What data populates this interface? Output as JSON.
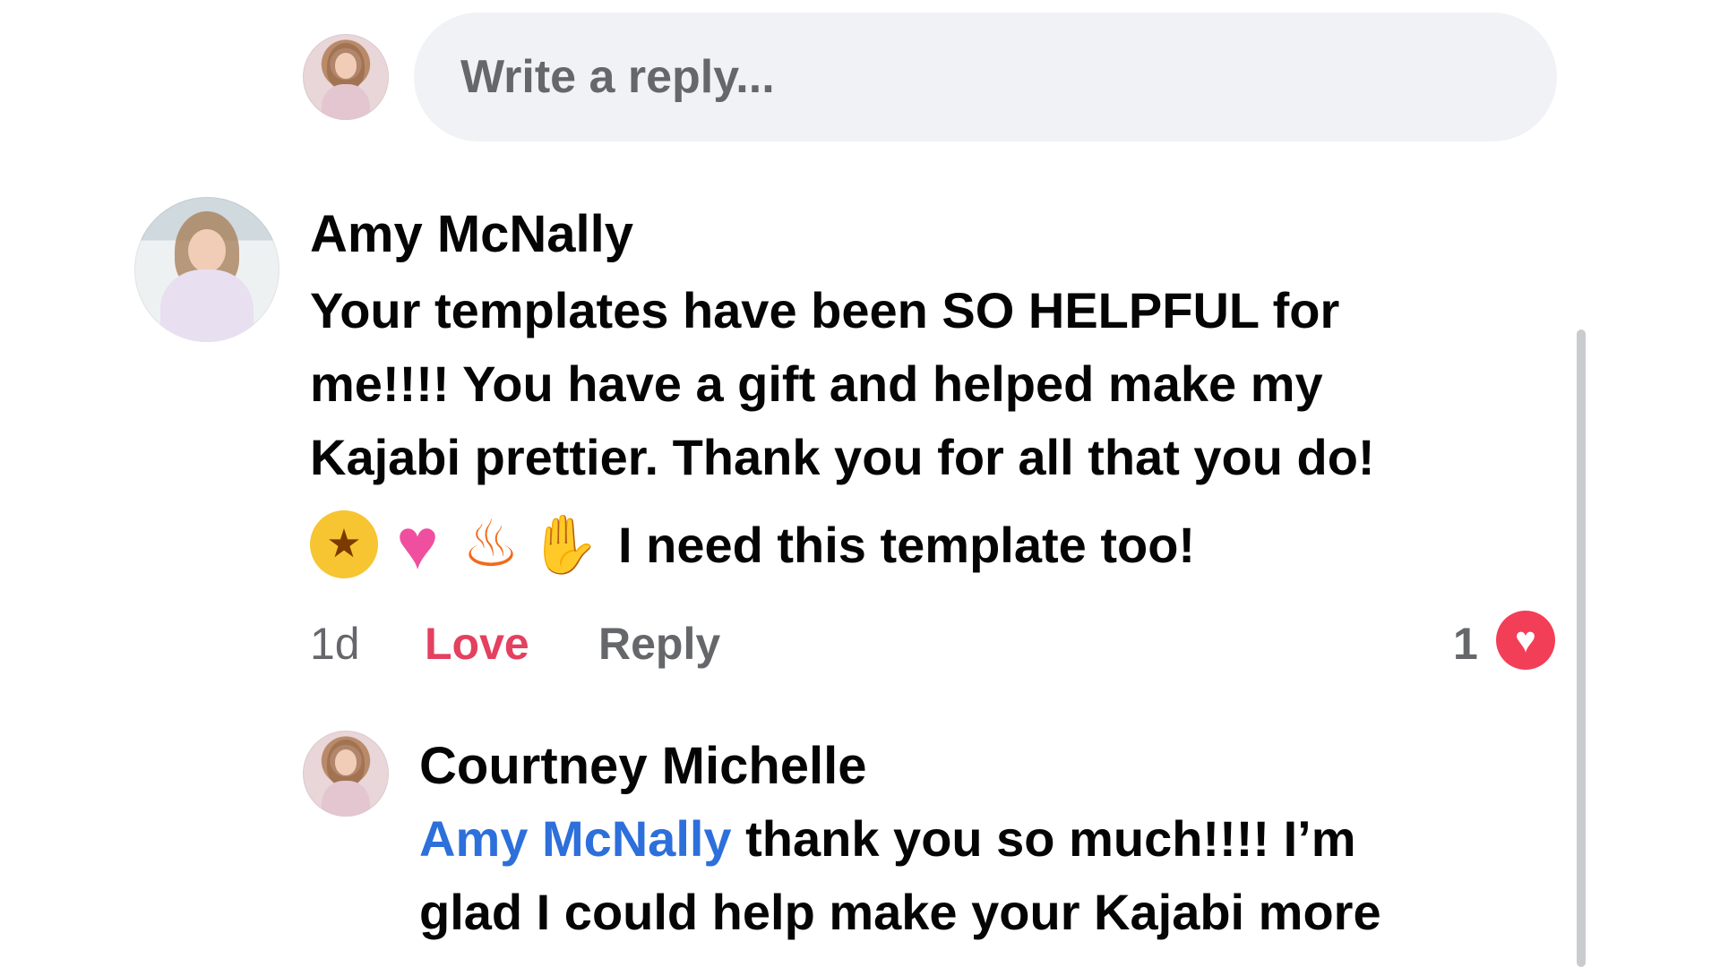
{
  "reply_input": {
    "placeholder": "Write a reply..."
  },
  "comment": {
    "author": "Amy McNally",
    "text_lines": [
      "Your templates have been SO HELPFUL for",
      "me!!!! You have a gift and helped make my",
      "Kajabi prettier. Thank you for all that you do!"
    ],
    "emoji_line": {
      "emojis": [
        "star-struck-emoji",
        "sparkling-heart-emoji",
        "fire-emoji",
        "clapping-hands-emoji"
      ],
      "text": "I need this template too!"
    },
    "time": "1d",
    "love_label": "Love",
    "reply_label": "Reply",
    "reaction_count": "1",
    "reaction_color": "#f33e58"
  },
  "reply": {
    "author": "Courtney Michelle",
    "mention": "Amy McNally",
    "text_line1": " thank you so much!!!! I’m",
    "text_line2": "glad I could help make your Kajabi more"
  },
  "colors": {
    "mention": "#2d6fdb",
    "love": "#e4405f",
    "muted": "#65676b",
    "input_bg": "#f0f2f5"
  }
}
